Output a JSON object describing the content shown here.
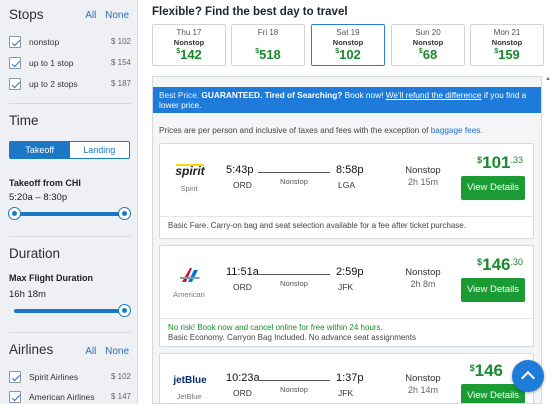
{
  "sidebar": {
    "stops": {
      "title": "Stops",
      "all": "All",
      "none": "None",
      "items": [
        {
          "label": "nonstop",
          "price": "$ 102"
        },
        {
          "label": "up to 1 stop",
          "price": "$ 154"
        },
        {
          "label": "up to 2 stops",
          "price": "$ 187"
        }
      ]
    },
    "time": {
      "title": "Time",
      "tab_takeoff": "Takeoff",
      "tab_landing": "Landing",
      "takeoff_label": "Takeoff from CHI",
      "range": "5:20a  –  8:30p"
    },
    "duration": {
      "title": "Duration",
      "max_label": "Max Flight Duration",
      "value": "16h 18m"
    },
    "airlines": {
      "title": "Airlines",
      "all": "All",
      "none": "None",
      "items": [
        {
          "label": "Spirit Airlines",
          "price": "$ 102"
        },
        {
          "label": "American Airlines",
          "price": "$ 147"
        }
      ]
    }
  },
  "main": {
    "title": "Flexible? Find the best day to travel",
    "dates": [
      {
        "day": "Thu 17",
        "stops": "Nonstop",
        "cur": "$",
        "amount": "142",
        "selected": false
      },
      {
        "day": "Fri 18",
        "stops": "",
        "cur": "$",
        "amount": "518",
        "selected": false
      },
      {
        "day": "Sat 19",
        "stops": "Nonstop",
        "cur": "$",
        "amount": "102",
        "selected": true
      },
      {
        "day": "Sun 20",
        "stops": "Nonstop",
        "cur": "$",
        "amount": "68",
        "selected": false
      },
      {
        "day": "Mon 21",
        "stops": "Nonstop",
        "cur": "$",
        "amount": "159",
        "selected": false
      }
    ],
    "banner": {
      "part1": "Best Price. ",
      "part2": "GUARANTEED.",
      "part3": " Tired of Searching?",
      "part4": " Book now! ",
      "link": "We'll refund the difference",
      "part5": " if you find a lower price."
    },
    "info": {
      "text": "Prices are per person and inclusive of taxes and fees with the exception of ",
      "link": "baggage fees."
    },
    "flights": [
      {
        "airline": "Spirit",
        "logo_text": "spirit",
        "dep_time": "5:43p",
        "dep_airport": "ORD",
        "mid": "Nonstop",
        "arr_time": "8:58p",
        "arr_airport": "LGA",
        "stops": "Nonstop",
        "duration": "2h 15m",
        "cur": "$",
        "price": "101",
        "cents": ".33",
        "button": "View Details",
        "note_green": "",
        "note": "Basic Fare. Carry-on bag and seat selection available for a fee after ticket purchase."
      },
      {
        "airline": "American",
        "logo_text": "",
        "dep_time": "11:51a",
        "dep_airport": "ORD",
        "mid": "Nonstop",
        "arr_time": "2:59p",
        "arr_airport": "JFK",
        "stops": "Nonstop",
        "duration": "2h 8m",
        "cur": "$",
        "price": "146",
        "cents": ".30",
        "button": "View Details",
        "note_green": "No risk! Book now and cancel online for free within 24 hours.",
        "note": "Basic Economy. Carryon Bag Included. No advance seat assignments"
      },
      {
        "airline": "JetBlue",
        "logo_text": "jetBlue",
        "dep_time": "10:23a",
        "dep_airport": "ORD",
        "mid": "Nonstop",
        "arr_time": "1:37p",
        "arr_airport": "JFK",
        "stops": "Nonstop",
        "duration": "2h 14m",
        "cur": "$",
        "price": "146",
        "cents": "",
        "button": "View Details",
        "note_green": "",
        "note": ""
      }
    ]
  },
  "colors": {
    "accent": "#1e7bd9",
    "price_green": "#1a8a2e",
    "button_green": "#1a9b33"
  },
  "icons": [
    "checkbox-checked-icon",
    "spirit-logo",
    "american-logo",
    "jetblue-logo",
    "scroll-to-top-icon"
  ]
}
